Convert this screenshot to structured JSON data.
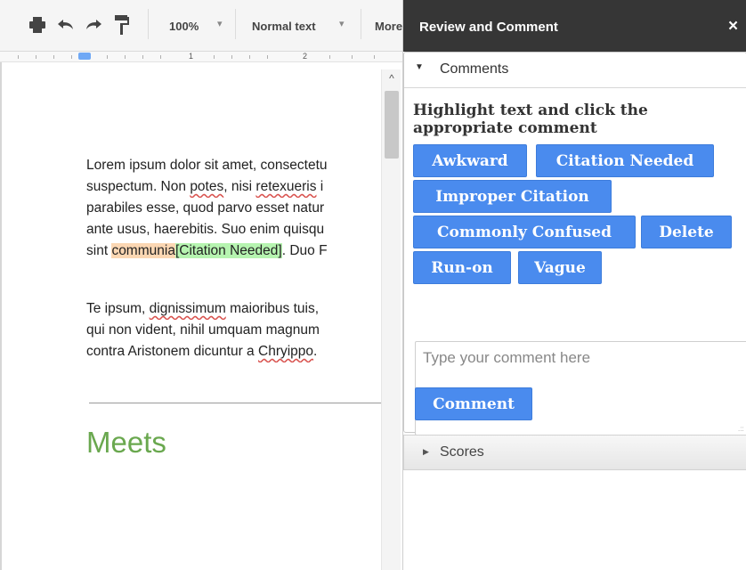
{
  "toolbar": {
    "zoom": "100%",
    "style": "Normal text",
    "more": "More",
    "icons": [
      "print-icon",
      "undo-icon",
      "redo-icon",
      "paint-format-icon"
    ]
  },
  "ruler": {
    "marks": [
      "1",
      "2"
    ]
  },
  "document": {
    "paragraph1": {
      "line1": "Lorem ipsum dolor sit amet, consectetu",
      "line2_a": "suspectum. Non ",
      "line2_b": "potes",
      "line2_c": ", nisi ",
      "line2_d": "retexueris",
      "line2_e": " i",
      "line3": "parabiles esse, quod parvo esset natur",
      "line4": "ante usus, haerebitis. Suo enim quisqu",
      "line5_a": "sint ",
      "line5_highlight": "communia",
      "line5_tag": "[Citation Needed]",
      "line5_b": ". Duo F"
    },
    "paragraph2": {
      "line1_a": "Te ipsum, ",
      "line1_b": "dignissimum",
      "line1_c": " maioribus tuis,",
      "line2": "qui non vident, nihil umquam magnum",
      "line3_a": "contra Aristonem dicuntur a ",
      "line3_b": "Chryippo",
      "line3_c": "."
    },
    "heading": "Meets"
  },
  "panel": {
    "title": "Review and Comment",
    "close": "×",
    "comments": {
      "caret": "▼",
      "label": "Comments",
      "instruction": "Highlight text and click the appropriate comment",
      "buttons": {
        "awkward": "Awkward",
        "citation_needed": "Citation Needed",
        "improper_citation": "Improper Citation",
        "commonly_confused": "Commonly Confused",
        "delete": "Delete",
        "run_on": "Run-on",
        "vague": "Vague"
      },
      "input_placeholder": "Type your comment here",
      "submit": "Comment"
    },
    "scores": {
      "caret": "▶",
      "label": "Scores"
    }
  },
  "colors": {
    "accent": "#4a8bee",
    "header_bg": "#363636",
    "highlight_orange": "#fbd7b3",
    "highlight_green": "#b6f4b0",
    "heading_green": "#6aa84f"
  }
}
